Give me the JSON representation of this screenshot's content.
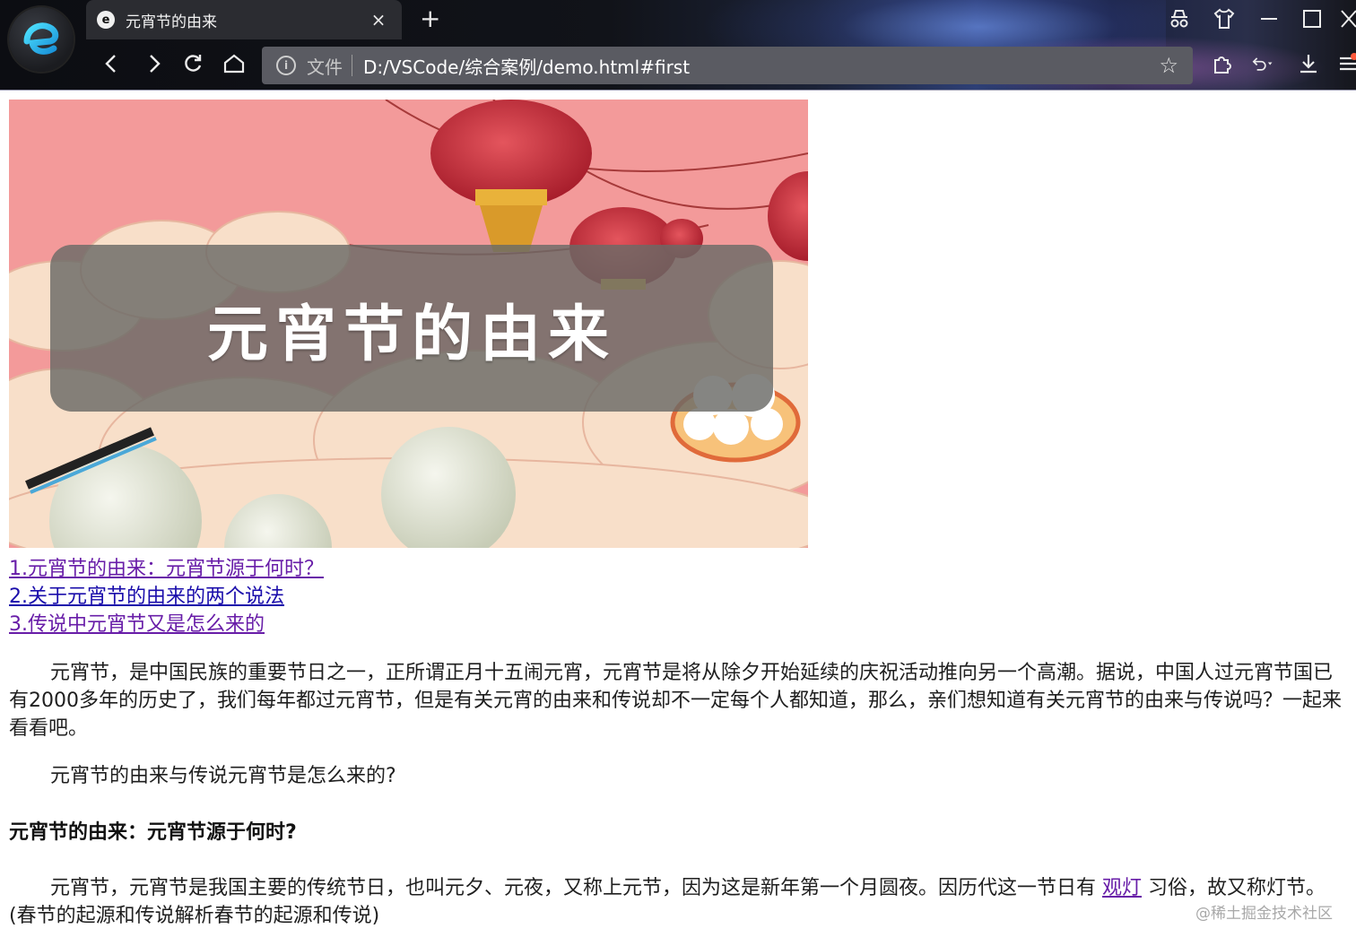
{
  "browser": {
    "tab_favicon": "e",
    "tab_title": "元宵节的由来",
    "tab_close": "×",
    "new_tab": "+",
    "address": {
      "scheme_label": "文件",
      "url": "D:/VSCode/综合案例/demo.html#first"
    }
  },
  "banner": {
    "caption": "元宵节的由来"
  },
  "toc": [
    {
      "label": "1.元宵节的由来：元宵节源于何时？",
      "visited": true
    },
    {
      "label": "2.关于元宵节的由来的两个说法",
      "visited": false
    },
    {
      "label": "3.传说中元宵节又是怎么来的",
      "visited": true
    }
  ],
  "article": {
    "intro": "元宵节，是中国民族的重要节日之一，正所谓正月十五闹元宵，元宵节是将从除夕开始延续的庆祝活动推向另一个高潮。据说，中国人过元宵节国已有2000多年的历史了，我们每年都过元宵节，但是有关元宵的由来和传说却不一定每个人都知道，那么，亲们想知道有关元宵节的由来与传说吗？一起来看看吧。",
    "question": "元宵节的由来与传说元宵节是怎么来的?",
    "section1_heading": "元宵节的由来：元宵节源于何时?",
    "section1_text_before": "元宵节，元宵节是我国主要的传统节日，也叫元夕、元夜，又称上元节，因为这是新年第一个月圆夜。因历代这一节日有 ",
    "section1_link": "观灯",
    "section1_text_after": " 习俗，故又称灯节。(春节的起源和传说解析春节的起源和传说)"
  },
  "watermark": "@稀土掘金技术社区",
  "colors": {
    "link": "#1a0dab",
    "link_visited": "#681da8",
    "banner_bg": "#f39a9a",
    "lantern_red": "#c8303a"
  }
}
